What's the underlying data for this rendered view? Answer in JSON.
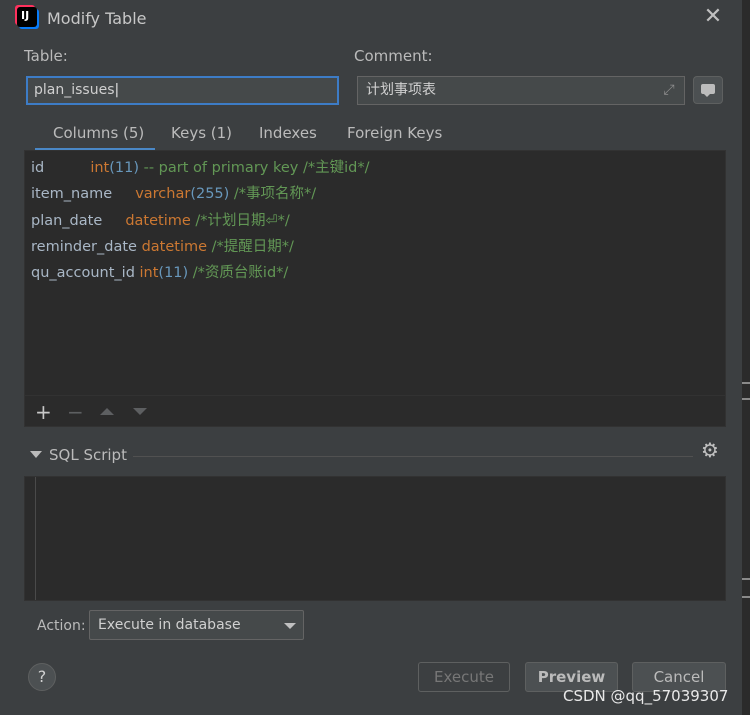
{
  "window": {
    "title": "Modify Table"
  },
  "form": {
    "table_label": "Table:",
    "table_value": "plan_issues",
    "comment_label": "Comment:",
    "comment_value": "计划事项表"
  },
  "tabs": [
    {
      "label": "Columns (5)",
      "active": true
    },
    {
      "label": "Keys (1)"
    },
    {
      "label": "Indexes"
    },
    {
      "label": "Foreign Keys"
    }
  ],
  "columns": [
    {
      "name": "id",
      "type": "int",
      "size": "(11)",
      "extra": " -- part of primary key",
      "comment": " /*主键id*/"
    },
    {
      "name": "item_name",
      "type": "varchar",
      "size": "(255)",
      "extra": "",
      "comment": " /*事项名称*/"
    },
    {
      "name": "plan_date",
      "type": "datetime",
      "size": "",
      "extra": "",
      "comment": " /*计划日期⏎*/"
    },
    {
      "name": "reminder_date",
      "type": "datetime",
      "size": "",
      "extra": "",
      "comment": " /*提醒日期*/"
    },
    {
      "name": "qu_account_id",
      "type": "int",
      "size": "(11)",
      "extra": "",
      "comment": " /*资质台账id*/"
    }
  ],
  "toolbar": {
    "add": "+",
    "remove": "−"
  },
  "sql": {
    "title": "SQL Script"
  },
  "action": {
    "label": "Action:",
    "value": "Execute in database"
  },
  "buttons": {
    "help": "?",
    "execute": "Execute",
    "preview": "Preview",
    "cancel": "Cancel"
  },
  "watermark": "CSDN @qq_57039307",
  "icons": {
    "close": "close-icon",
    "expand": "expand-icon",
    "comment": "comment-icon",
    "settings": "gear-icon",
    "collapse": "chevron-down-icon",
    "dropdown": "chevron-down-icon"
  },
  "colors": {
    "background": "#3c3f41",
    "editor": "#2b2b2b",
    "accent": "#4a88c7",
    "keyword": "#cc7832",
    "number": "#6897bb",
    "comment": "#629755",
    "text": "#a9b7c6"
  }
}
